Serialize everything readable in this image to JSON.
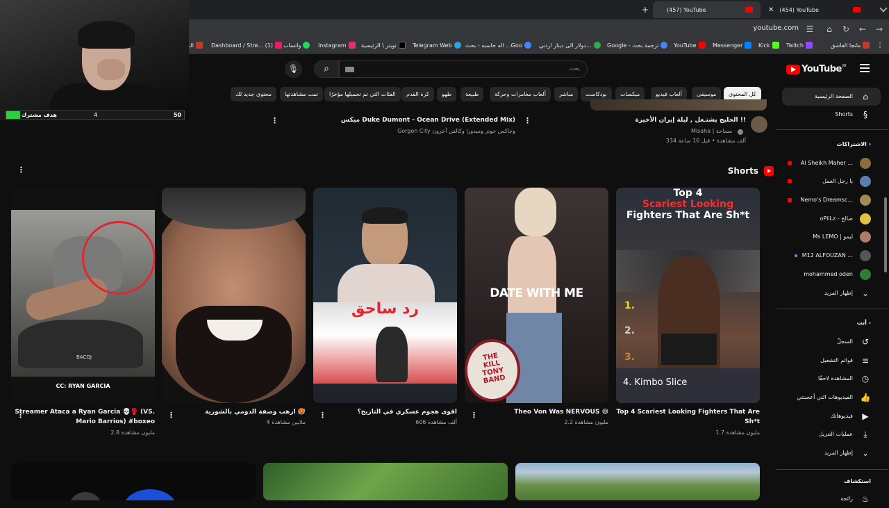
{
  "browser": {
    "tabs": [
      {
        "label": "(457) YouTube",
        "active": true
      },
      {
        "label": "(454) YouTube",
        "active": false
      }
    ],
    "new_tab": "+",
    "url": "youtube.com",
    "bookmarks": [
      {
        "label": "مانجا العاشق",
        "color": "#c0392b"
      },
      {
        "label": "Twitch",
        "color": "#9146ff"
      },
      {
        "label": "Kick",
        "color": "#53fc18"
      },
      {
        "label": "Messenger",
        "color": "#0084ff"
      },
      {
        "label": "YouTube",
        "color": "#ff0000"
      },
      {
        "label": "Google - ترجمة بحث",
        "color": "#4285f4"
      },
      {
        "label": "دولار الى دينار اردني...",
        "color": "#34a853"
      },
      {
        "label": "اله حاسبه - بحث ...Goo",
        "color": "#4285f4"
      },
      {
        "label": "Telegram Web",
        "color": "#2aa3e0"
      },
      {
        "label": "تويتر \\ الرئيسية",
        "color": "#000000"
      },
      {
        "label": "Instagram",
        "color": "#e1306c"
      },
      {
        "label": "واتساب",
        "color": "#25d366"
      },
      {
        "label": "Dashboard / Stre... (1)",
        "color": "#e91e63"
      },
      {
        "label": "الـ",
        "color": "#c0392b"
      }
    ]
  },
  "webcam_goal": {
    "label": "هدف مشترك",
    "current": "4",
    "target": "50",
    "progress": 0.08
  },
  "yt": {
    "logo": "YouTube",
    "logo_sup": "JO",
    "search_placeholder": "بحث",
    "chips": [
      "كل المحتوى",
      "موسيقى",
      "ألعاب فيديو",
      "ميكسات",
      "بودكاست",
      "مباشر",
      "ألعاب مغامرات وحركة",
      "طبيعة",
      "طهو",
      "كرة القدم",
      "الفئات التي تم تحميلها مؤخرًا",
      "تمت مشاهدتها",
      "محتوى جديد لك"
    ],
    "sidebar": {
      "home": "الصفحة الرئيسية",
      "shorts": "Shorts",
      "subs_head": "الاشتراكات",
      "subs": [
        {
          "name": "Al Sheikh Maher ...",
          "color": "#8a6d3b",
          "live": true
        },
        {
          "name": "يا رجل العمل",
          "color": "#5d7fb0",
          "live": true
        },
        {
          "name": "Nemo's Dreamsc...",
          "color": "#a08a5a",
          "live": true
        },
        {
          "name": "oPiiLz - صالح",
          "color": "#e0c341",
          "live": false
        },
        {
          "name": "Ms LEMO | ليمو",
          "color": "#b07a6a",
          "live": false
        },
        {
          "name": "M12 ALFOUZAN ...",
          "color": "#555555",
          "live": false,
          "dot": true
        },
        {
          "name": "mohammed oden",
          "color": "#2e7d32",
          "live": false
        }
      ],
      "show_more": "إظهار المزيد",
      "you_head": "أنت",
      "you_items": [
        {
          "label": "السجلّ",
          "icon": "history-icon"
        },
        {
          "label": "قوائم التشغيل",
          "icon": "playlists-icon"
        },
        {
          "label": "المشاهدة لاحقًا",
          "icon": "watch-later-icon"
        },
        {
          "label": "الفيديوهات التي أعجبتني",
          "icon": "like-icon"
        },
        {
          "label": "فيديوهاتك",
          "icon": "your-videos-icon"
        },
        {
          "label": "عمليات التنزيل",
          "icon": "download-icon"
        }
      ],
      "show_more_2": "إظهار المزيد",
      "explore_head": "استكشاف",
      "explore_first": "رائجة"
    },
    "top_videos": [
      {
        "title": "الخليج يشتـعل , ليلة إيران الأخيرة !!",
        "channel": "Misaha | مساحة",
        "meta": "334 ألف مشاهدة • قبل 16 ساعة"
      },
      {
        "title": "ميكس Duke Dumont - Ocean Drive (Extended Mix)",
        "channel": "Gorgon City وجاكس جونز وميدوزا وكالفن آخرون"
      }
    ],
    "shorts_title": "Shorts",
    "shorts": [
      {
        "title": "Top 4 Scariest Looking Fighters That Are Sh*t",
        "views": "1.7 مليون مشاهدة",
        "overlay_top": "Top 4",
        "overlay_red": "Scariest Looking",
        "overlay_sub": "Fighters That Are Sh*t",
        "overlay_bottom": "4. Kimbo Slice",
        "n1": "1.",
        "n2": "2.",
        "n3": "3."
      },
      {
        "title": "Theo Von Was NERVOUS 😅",
        "views": "2.2 مليون مشاهدة",
        "overlay": "DATE WITH ME",
        "drum": "THE KILL TONY BAND"
      },
      {
        "title": "اقوى هجوم عسكري في التاريخ؟",
        "views": "606 ألف مشاهدة",
        "overlay": "رد ساحق"
      },
      {
        "title": "ارهب وصفة الدومي بالشورية 🥵",
        "views": "4 ملايين مشاهدة"
      },
      {
        "title": "Streamer Ataca a Ryan Garcia 💀🥊 (VS. Mario Barrios)  #boxeo",
        "views": "2.8 مليون مشاهدة",
        "caption": "CC: RYAN GARCIA",
        "tag": "BACOJ"
      }
    ]
  }
}
